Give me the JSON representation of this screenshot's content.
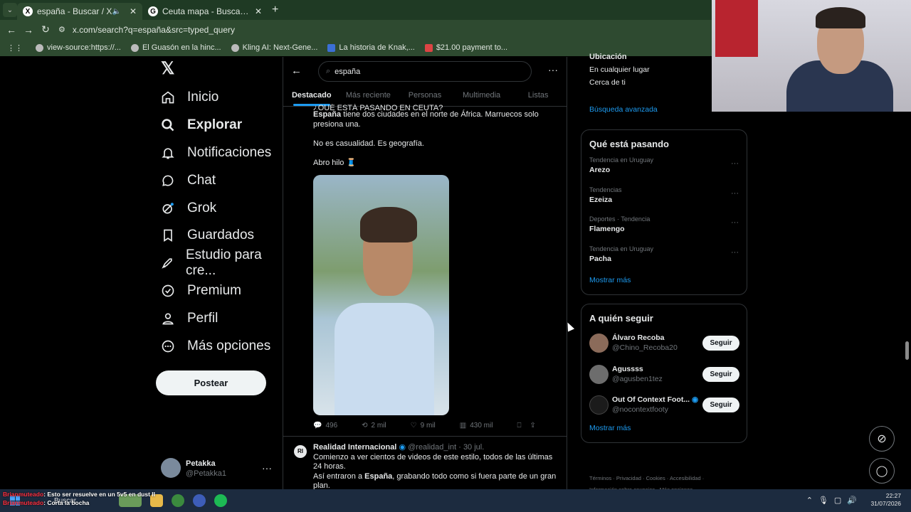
{
  "browser": {
    "tabs": [
      {
        "title": "españa - Buscar / X",
        "icon": "x-logo-icon"
      },
      {
        "title": "Ceuta mapa - Buscar con Google",
        "icon": "google-icon"
      }
    ],
    "url": "x.com/search?q=españa&src=typed_query",
    "bookmarks": [
      "view-source:https://...",
      "El Guasón en la hinc...",
      "Kling AI: Next-Gene...",
      "La historia de Knak,...",
      "$21.00 payment to..."
    ]
  },
  "nav": {
    "items": [
      {
        "label": "Inicio",
        "icon": "home-icon"
      },
      {
        "label": "Explorar",
        "icon": "search-icon"
      },
      {
        "label": "Notificaciones",
        "icon": "bell-icon"
      },
      {
        "label": "Chat",
        "icon": "chat-icon"
      },
      {
        "label": "Grok",
        "icon": "grok-icon"
      },
      {
        "label": "Guardados",
        "icon": "bookmark-icon"
      },
      {
        "label": "Estudio para cre...",
        "icon": "rocket-icon"
      },
      {
        "label": "Premium",
        "icon": "verified-icon"
      },
      {
        "label": "Perfil",
        "icon": "person-icon"
      },
      {
        "label": "Más opciones",
        "icon": "more-circle-icon"
      }
    ],
    "post_button": "Postear"
  },
  "user": {
    "name": "Petakka",
    "handle": "@Petakka1"
  },
  "search": {
    "query": "españa"
  },
  "search_tabs": [
    "Destacado",
    "Más reciente",
    "Personas",
    "Multimedia",
    "Listas"
  ],
  "tweet1": {
    "partial_header": "¿QUÉ ESTÁ PASANDO EN CEUTA?",
    "line1_bold": "España",
    "line1_rest": " tiene dos ciudades en el norte de África. Marruecos solo presiona una.",
    "line2": "No es casualidad. Es geografía.",
    "line3": "Abro hilo 🧵",
    "replies": "496",
    "reposts": "2 mil",
    "likes": "9 mil",
    "views": "430 mil"
  },
  "tweet2": {
    "avatar_text": "RI",
    "author": "Realidad Internacional",
    "handle": "@realidad_int",
    "date": "· 30 jul.",
    "line1": "Comienzo a ver cientos de videos de este estilo, todos de las últimas 24 horas.",
    "line2_pre": "Así entraron a ",
    "line2_bold": "España",
    "line2_post": ", grabando todo como si fuera parte de un gran plan."
  },
  "search_filters": {
    "partial_top": "Ubicación",
    "opt1": "En cualquier lugar",
    "opt2": "Cerca de ti",
    "advanced": "Búsqueda avanzada"
  },
  "trends": {
    "title": "Qué está pasando",
    "items": [
      {
        "context": "Tendencia en Uruguay",
        "name": "Arezo"
      },
      {
        "context": "Tendencias",
        "name": "Ezeiza"
      },
      {
        "context": "Deportes · Tendencia",
        "name": "Flamengo"
      },
      {
        "context": "Tendencia en Uruguay",
        "name": "Pacha"
      }
    ],
    "show_more": "Mostrar más"
  },
  "who_to_follow": {
    "title": "A quién seguir",
    "items": [
      {
        "name": "Álvaro Recoba",
        "handle": "@Chino_Recoba20"
      },
      {
        "name": "Agussss",
        "handle": "@agusben1tez"
      },
      {
        "name": "Out Of Context Foot...",
        "handle": "@nocontextfooty"
      }
    ],
    "follow_label": "Seguir",
    "show_more": "Mostrar más"
  },
  "footer": {
    "line1": "Términos · Privacidad · Cookies · Accesibilidad ·",
    "line2": "Información sobre anuncios · Más opciones ···"
  },
  "chat_overlay": [
    {
      "user": "Brianmuteado",
      "msg": ": Esto ser resuelve en un 5v5 en dust II"
    },
    {
      "user": "Brianmuteado",
      "msg": ": Corta la bocha"
    }
  ],
  "taskbar": {
    "search": "Buscar",
    "time": "22:27",
    "date": "31/07/2026"
  },
  "colors": {
    "accent": "#1d9bf0",
    "background": "#000000",
    "browser_frame": "#2e4a30"
  }
}
